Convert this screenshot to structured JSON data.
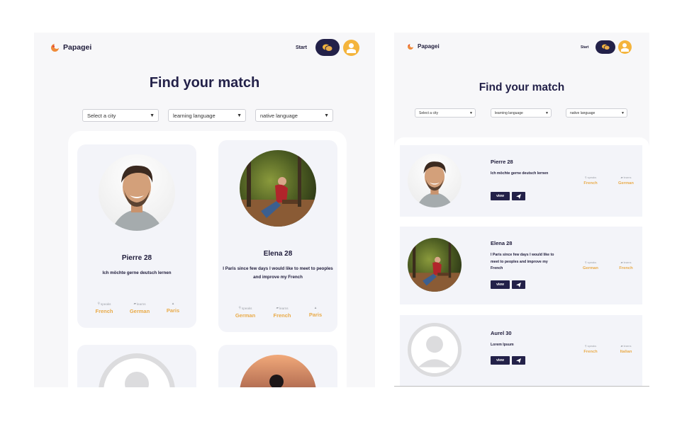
{
  "screen_desktop": {
    "brand": "Papagei",
    "nav": {
      "start": "Start"
    },
    "title": "Find your match",
    "filters": {
      "city": "Select a city",
      "learning": "learning language",
      "native": "native language"
    },
    "profiles": [
      {
        "name": "Pierre 28",
        "bio": "Ich möchte gerne deutsch lernen",
        "speaks_label": "speaks",
        "speaks": "French",
        "learns_label": "learns",
        "learns": "German",
        "city": "Paris"
      },
      {
        "name": "Elena 28",
        "bio": "I Paris since few days I would like to meet to peoples and improve my French",
        "speaks_label": "speaks",
        "speaks": "German",
        "learns_label": "learns",
        "learns": "French",
        "city": "Paris"
      }
    ]
  },
  "screen_mobile": {
    "brand": "Papagei",
    "nav": {
      "start": "Start"
    },
    "title": "Find your match",
    "filters": {
      "city": "Select a city",
      "learning": "learning language",
      "native": "native language"
    },
    "view_label": "view",
    "profiles": [
      {
        "name": "Pierre 28",
        "bio": "Ich möchte gerne deutsch lernen",
        "speaks_label": "speaks",
        "speaks": "French",
        "learns_label": "learns",
        "learns": "German"
      },
      {
        "name": "Elena 28",
        "bio": "I Paris since few days I would like to meet to peoples and improve my French",
        "speaks_label": "speaks",
        "speaks": "German",
        "learns_label": "learns",
        "learns": "French"
      },
      {
        "name": "Aurel 30",
        "bio": "Lorem Ipsum",
        "speaks_label": "speaks",
        "speaks": "French",
        "learns_label": "learns",
        "learns": "Italian"
      }
    ]
  },
  "icons": {
    "logo": "parrot-logo-icon",
    "chat": "chat-bubbles-icon",
    "account": "user-avatar-icon",
    "speaks": "search-icon",
    "learns": "chat-icon",
    "city": "building-icon",
    "send": "paper-plane-icon",
    "dropdown": "chevron-down-icon"
  },
  "colors": {
    "navy": "#232149",
    "accent": "#e9ab4a",
    "avatar": "#f4b43c",
    "card": "#f3f4f9",
    "background": "#f7f7f9"
  }
}
